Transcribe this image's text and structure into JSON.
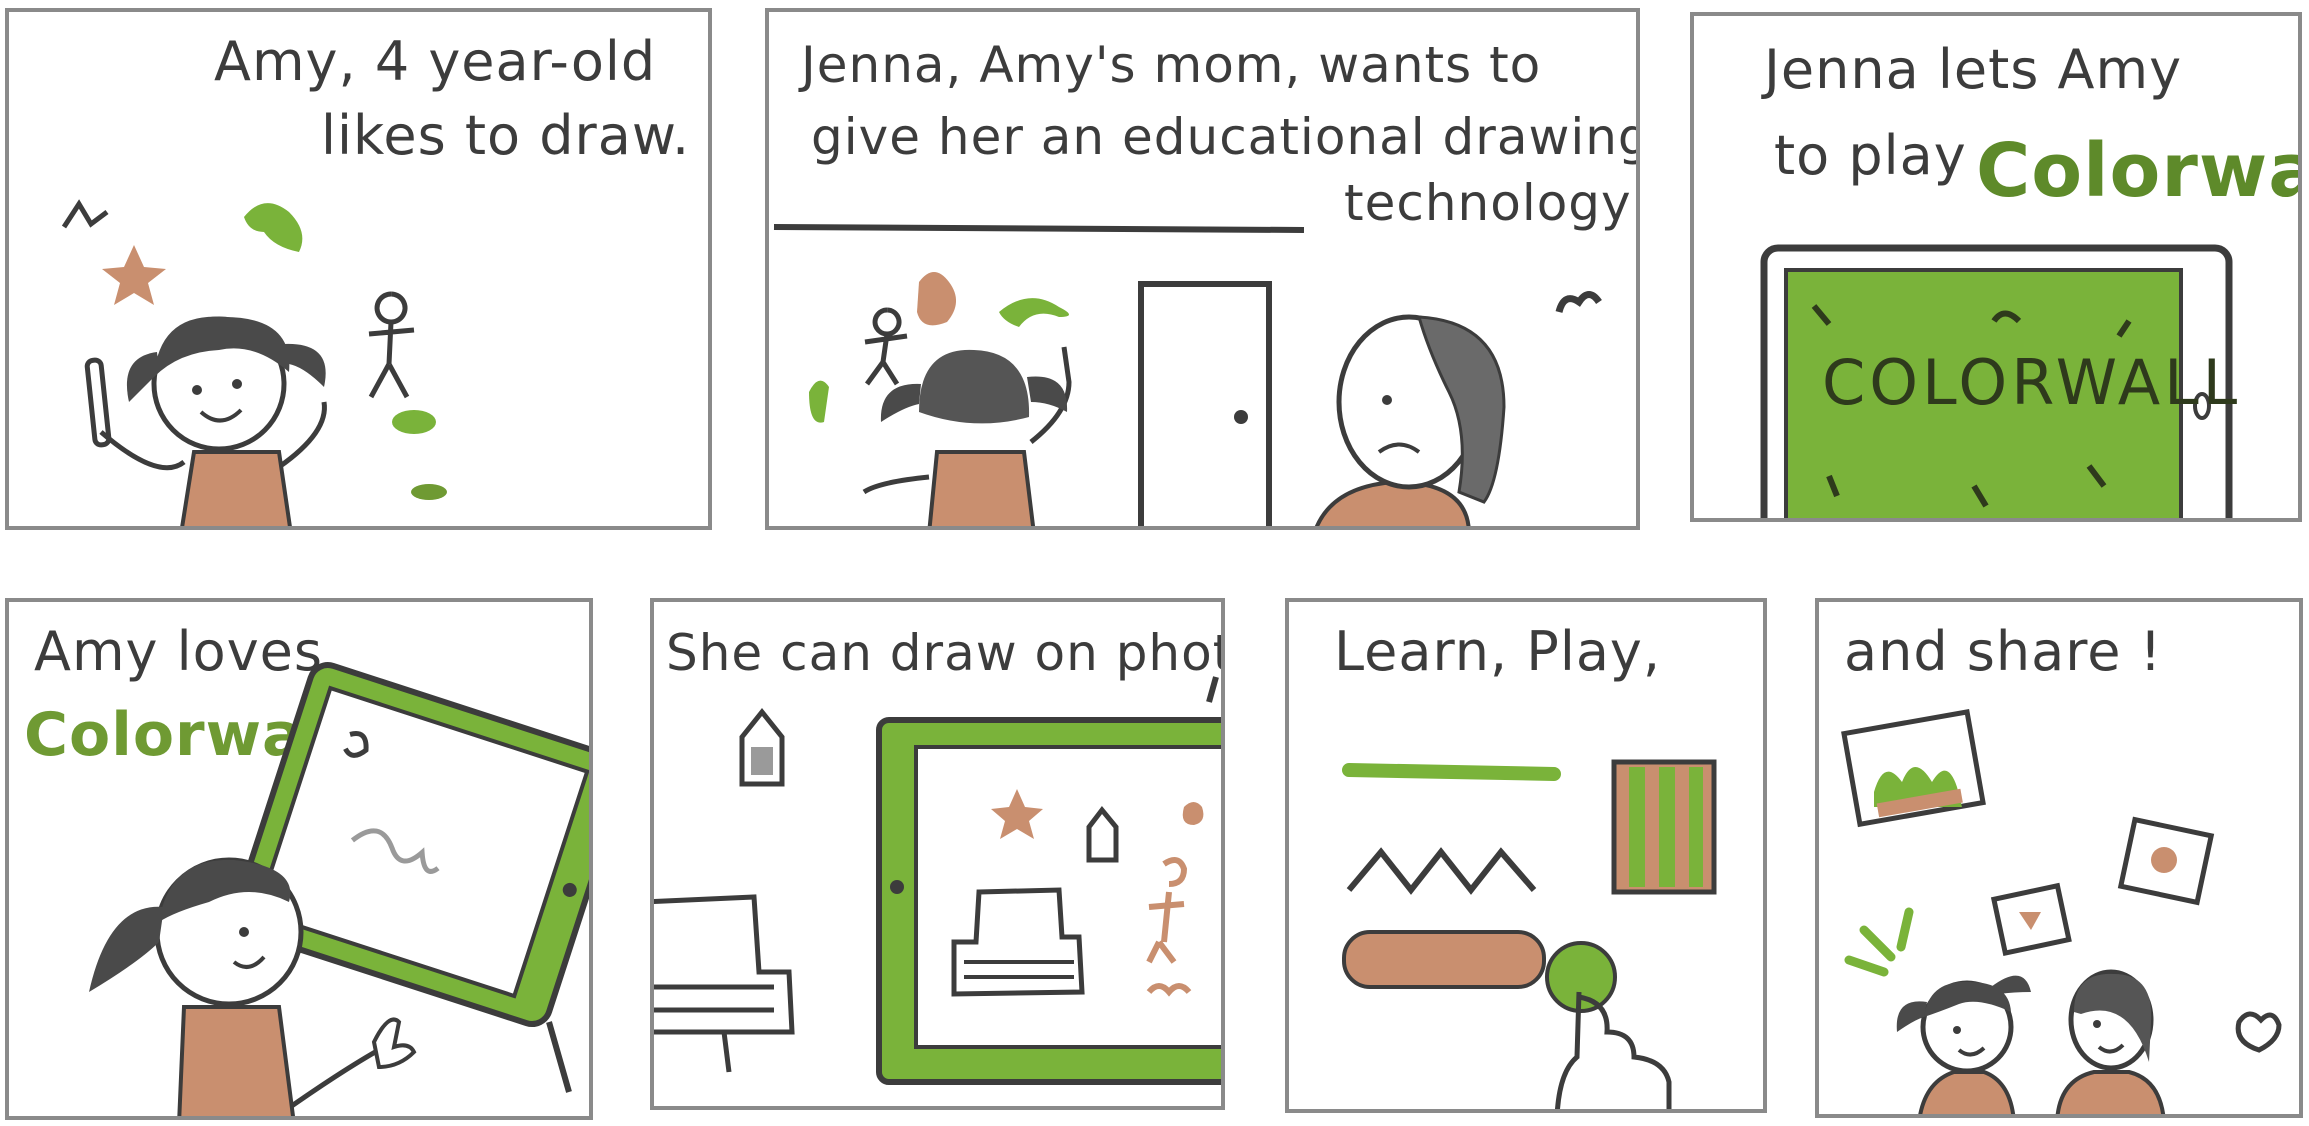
{
  "colors": {
    "ink": "#3c3c3c",
    "green": "#7ab33a",
    "dark_green": "#5e8a2a",
    "skin": "#c98f6f",
    "frame": "#8a8a8a"
  },
  "panels": [
    {
      "id": "p1",
      "caption_lines": [
        "Amy, 4 year-old",
        "likes to draw."
      ]
    },
    {
      "id": "p2",
      "caption_lines": [
        "Jenna, Amy's mom, wants to",
        "give her an educational drawing",
        "technology"
      ]
    },
    {
      "id": "p3",
      "caption_lines": [
        "Jenna lets Amy",
        "to play"
      ],
      "brand": "Colorwall",
      "screen_label": "COLORWALL"
    },
    {
      "id": "p4",
      "caption_lines": [
        "Amy loves"
      ],
      "brand": "Colorwall"
    },
    {
      "id": "p5",
      "caption_lines": [
        "She can draw on photo"
      ]
    },
    {
      "id": "p6",
      "caption_lines": [
        "Learn, Play,"
      ]
    },
    {
      "id": "p7",
      "caption_lines": [
        "and share !"
      ]
    }
  ]
}
